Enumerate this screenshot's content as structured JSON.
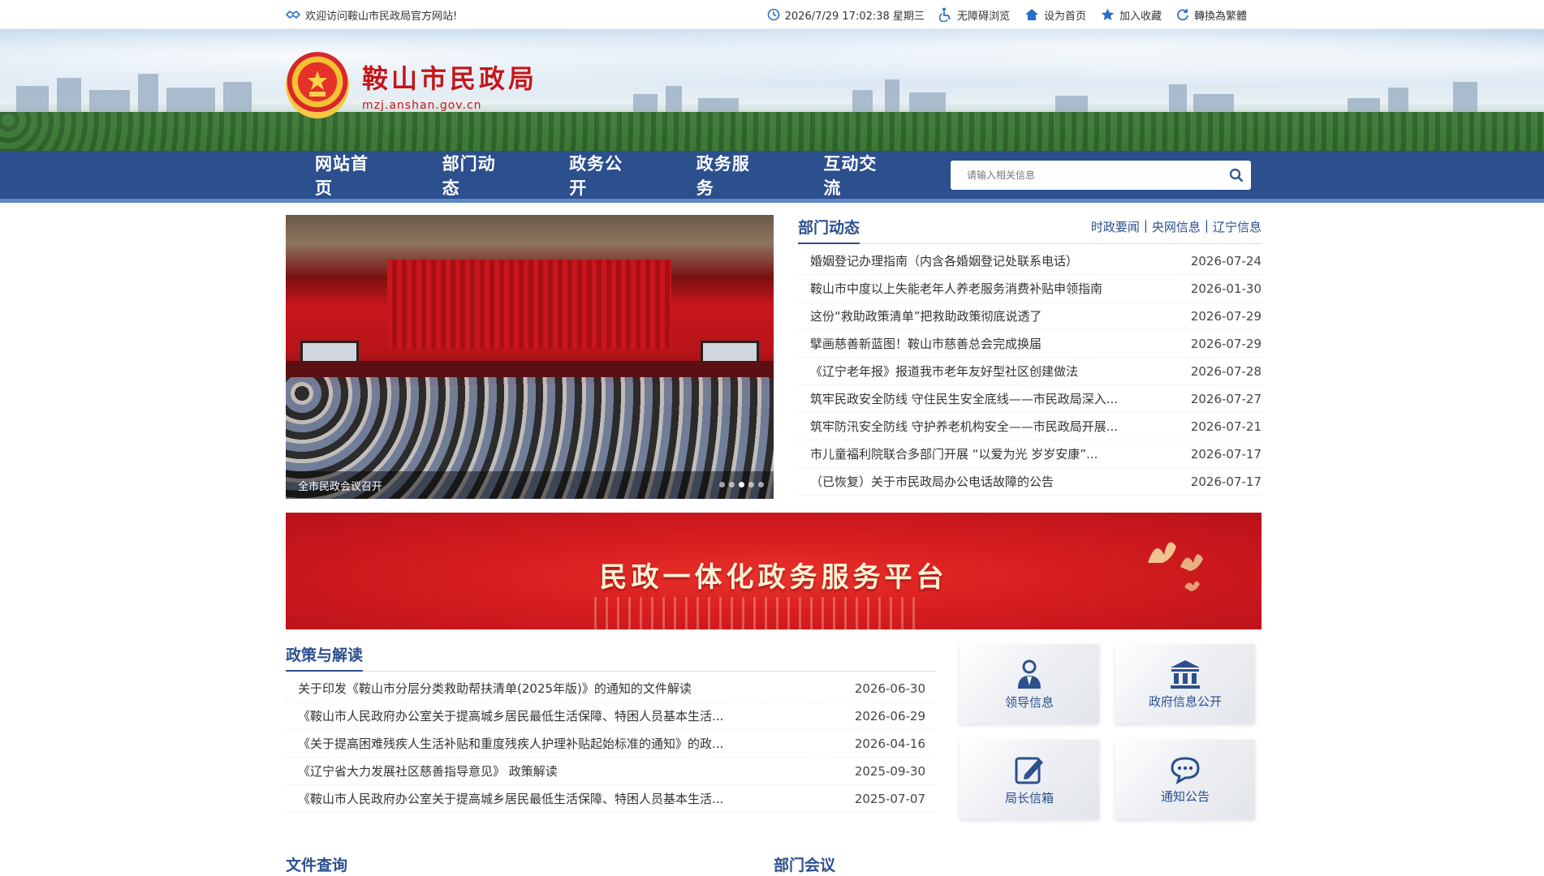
{
  "topbar": {
    "welcome": "欢迎访问鞍山市民政局官方网站!",
    "datetime": "2026/7/29 17:02:38 星期三",
    "accessibility": "无障碍浏览",
    "set_home": "设为首页",
    "favorite": "加入收藏",
    "traditional": "轉換為繁體"
  },
  "header": {
    "title": "鞍山市民政局",
    "domain": "mzj.anshan.gov.cn"
  },
  "nav": {
    "items": [
      "网站首页",
      "部门动态",
      "政务公开",
      "政务服务",
      "互动交流"
    ],
    "search_placeholder": "请输入相关信息"
  },
  "slider": {
    "caption": "全市民政会议召开",
    "dot_count": 5,
    "active_dot": 3
  },
  "dept_news": {
    "title": "部门动态",
    "links": [
      "时政要闻",
      "央网信息",
      "辽宁信息"
    ],
    "items": [
      {
        "title": "婚姻登记办理指南（内含各婚姻登记处联系电话）",
        "date": "2026-07-24"
      },
      {
        "title": "鞍山市中度以上失能老年人养老服务消费补贴申领指南",
        "date": "2026-01-30"
      },
      {
        "title": "这份“救助政策清单”把救助政策彻底说透了",
        "date": "2026-07-29"
      },
      {
        "title": "擘画慈善新蓝图！鞍山市慈善总会完成换届",
        "date": "2026-07-29"
      },
      {
        "title": "《辽宁老年报》报道我市老年友好型社区创建做法",
        "date": "2026-07-28"
      },
      {
        "title": "筑牢民政安全防线 守住民生安全底线——市民政局深入...",
        "date": "2026-07-27"
      },
      {
        "title": "筑牢防汛安全防线 守护养老机构安全——市民政局开展...",
        "date": "2026-07-21"
      },
      {
        "title": "市儿童福利院联合多部门开展 “以爱为光 岁岁安康”...",
        "date": "2026-07-17"
      },
      {
        "title": "（已恢复）关于市民政局办公电话故障的公告",
        "date": "2026-07-17"
      }
    ]
  },
  "promo": {
    "text": "民政一体化政务服务平台"
  },
  "policy": {
    "title": "政策与解读",
    "items": [
      {
        "title": "关于印发《鞍山市分层分类救助帮扶清单(2025年版)》的通知的文件解读",
        "date": "2026-06-30"
      },
      {
        "title": "《鞍山市人民政府办公室关于提高城乡居民最低生活保障、特困人员基本生活...",
        "date": "2026-06-29"
      },
      {
        "title": "《关于提高困难残疾人生活补贴和重度残疾人护理补贴起始标准的通知》的政...",
        "date": "2026-04-16"
      },
      {
        "title": "《辽宁省大力发展社区慈善指导意见》 政策解读",
        "date": "2025-09-30"
      },
      {
        "title": "《鞍山市人民政府办公室关于提高城乡居民最低生活保障、特困人员基本生活...",
        "date": "2025-07-07"
      }
    ]
  },
  "tiles": [
    {
      "label": "领导信息",
      "icon": "leader-icon"
    },
    {
      "label": "政府信息公开",
      "icon": "government-building-icon"
    },
    {
      "label": "局长信箱",
      "icon": "edit-mail-icon"
    },
    {
      "label": "通知公告",
      "icon": "chat-bubble-icon"
    }
  ],
  "bottom": {
    "left_title": "文件查询",
    "right_title": "部门会议"
  },
  "colors": {
    "primary": "#2c4f8e",
    "nav_border": "#5f87c5",
    "brand_red": "#c4161c"
  }
}
